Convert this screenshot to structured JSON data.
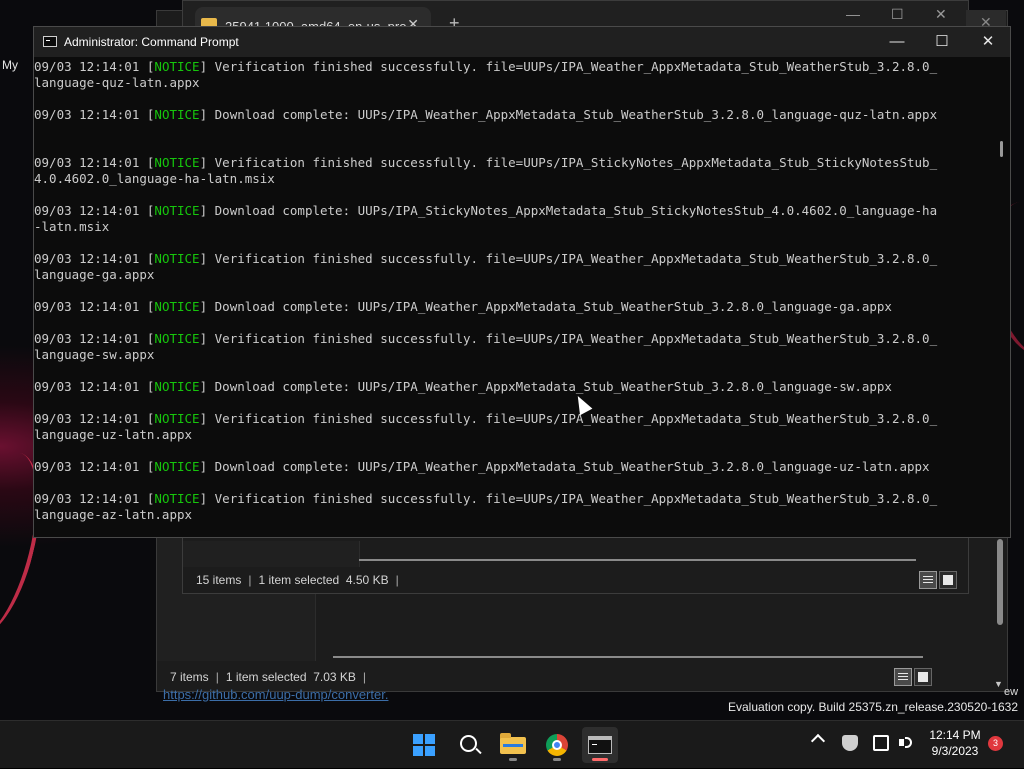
{
  "desktop": {
    "left_label": "My",
    "link": "https://github.com/uup-dump/converter.",
    "edge_label": "ew",
    "watermark": "Evaluation copy. Build 25375.zn_release.230520-1632"
  },
  "explorer_back": {
    "status_items": "7 items",
    "status_selected": "1 item selected",
    "status_size": "7.03 KB"
  },
  "explorer_mid": {
    "tab_title": "25941.1000_amd64_en-us_pro",
    "tab_close": "✕",
    "new_tab": "+",
    "status_items": "15 items",
    "status_selected": "1 item selected",
    "status_size": "4.50 KB"
  },
  "cmd": {
    "title": "Administrator: Command Prompt",
    "minimize": "—",
    "maximize": "☐",
    "close": "✕",
    "entries": [
      {
        "ts": "09/03 12:14:01",
        "level": "NOTICE",
        "msg": "Verification finished successfully. file=UUPs/IPA_Weather_AppxMetadata_Stub_WeatherStub_3.2.8.0_",
        "cont": "language-quz-latn.appx"
      },
      {
        "ts": "09/03 12:14:01",
        "level": "NOTICE",
        "msg": "Download complete: UUPs/IPA_Weather_AppxMetadata_Stub_WeatherStub_3.2.8.0_language-quz-latn.appx",
        "cont": ""
      },
      {
        "ts": "09/03 12:14:01",
        "level": "NOTICE",
        "msg": "Verification finished successfully. file=UUPs/IPA_StickyNotes_AppxMetadata_Stub_StickyNotesStub_",
        "cont": "4.0.4602.0_language-ha-latn.msix"
      },
      {
        "ts": "09/03 12:14:01",
        "level": "NOTICE",
        "msg": "Download complete: UUPs/IPA_StickyNotes_AppxMetadata_Stub_StickyNotesStub_4.0.4602.0_language-ha",
        "cont": "-latn.msix"
      },
      {
        "ts": "09/03 12:14:01",
        "level": "NOTICE",
        "msg": "Verification finished successfully. file=UUPs/IPA_Weather_AppxMetadata_Stub_WeatherStub_3.2.8.0_",
        "cont": "language-ga.appx"
      },
      {
        "ts": "09/03 12:14:01",
        "level": "NOTICE",
        "msg": "Download complete: UUPs/IPA_Weather_AppxMetadata_Stub_WeatherStub_3.2.8.0_language-ga.appx",
        "cont": ""
      },
      {
        "ts": "09/03 12:14:01",
        "level": "NOTICE",
        "msg": "Verification finished successfully. file=UUPs/IPA_Weather_AppxMetadata_Stub_WeatherStub_3.2.8.0_",
        "cont": "language-sw.appx"
      },
      {
        "ts": "09/03 12:14:01",
        "level": "NOTICE",
        "msg": "Download complete: UUPs/IPA_Weather_AppxMetadata_Stub_WeatherStub_3.2.8.0_language-sw.appx",
        "cont": ""
      },
      {
        "ts": "09/03 12:14:01",
        "level": "NOTICE",
        "msg": "Verification finished successfully. file=UUPs/IPA_Weather_AppxMetadata_Stub_WeatherStub_3.2.8.0_",
        "cont": "language-uz-latn.appx"
      },
      {
        "ts": "09/03 12:14:01",
        "level": "NOTICE",
        "msg": "Download complete: UUPs/IPA_Weather_AppxMetadata_Stub_WeatherStub_3.2.8.0_language-uz-latn.appx",
        "cont": ""
      },
      {
        "ts": "09/03 12:14:01",
        "level": "NOTICE",
        "msg": "Verification finished successfully. file=UUPs/IPA_Weather_AppxMetadata_Stub_WeatherStub_3.2.8.0_",
        "cont": "language-az-latn.appx"
      }
    ]
  },
  "taskbar": {
    "clock_time": "12:14 PM",
    "clock_date": "9/3/2023",
    "notification_count": "3"
  },
  "colors": {
    "notice": "#16c60c",
    "console_text": "#cccccc",
    "accent": "#3aa0ff"
  }
}
